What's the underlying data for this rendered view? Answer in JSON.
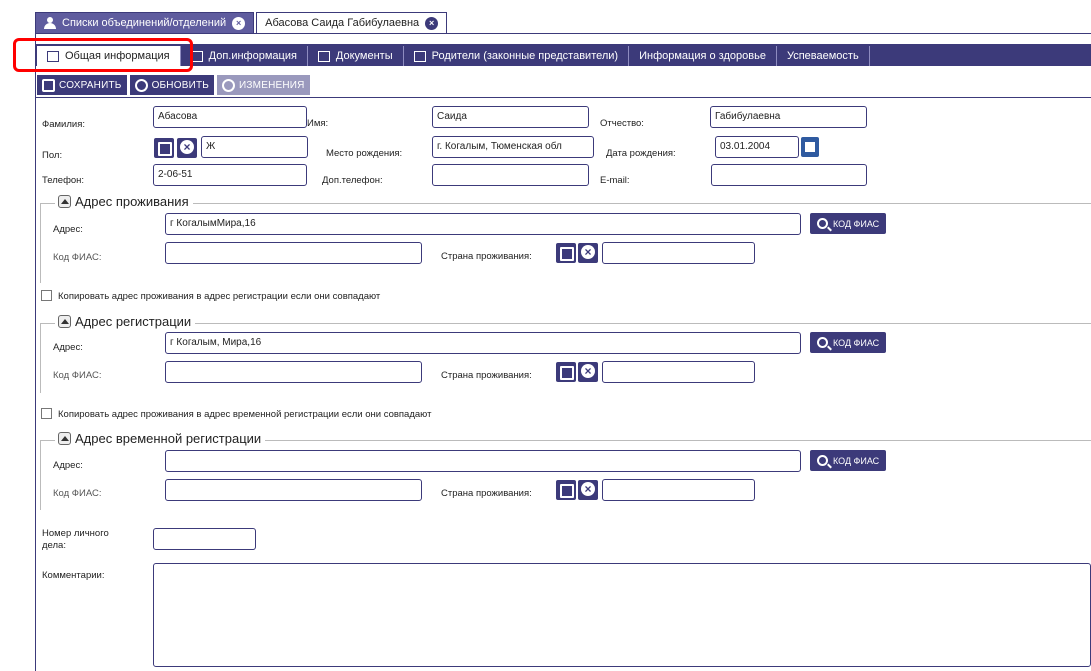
{
  "top_tabs": [
    {
      "label": "Списки объединений/отделений"
    },
    {
      "label": "Абасова Саида Габибулаевна"
    }
  ],
  "sub_tabs": [
    {
      "label": "Общая информация"
    },
    {
      "label": "Доп.информация"
    },
    {
      "label": "Документы"
    },
    {
      "label": "Родители (законные представители)"
    },
    {
      "label": "Информация о здоровье"
    },
    {
      "label": "Успеваемость"
    }
  ],
  "toolbar": {
    "save": "СОХРАНИТЬ",
    "refresh": "ОБНОВИТЬ",
    "changes": "ИЗМЕНЕНИЯ"
  },
  "person": {
    "surname_label": "Фамилия:",
    "surname": "Абасова",
    "name_label": "Имя:",
    "name": "Саида",
    "patronymic_label": "Отчество:",
    "patronymic": "Габибулаевна",
    "gender_label": "Пол:",
    "gender": "Ж",
    "birthplace_label": "Место рождения:",
    "birthplace": "г. Когалым, Тюменская обл",
    "birthdate_label": "Дата рождения:",
    "birthdate": "03.01.2004",
    "phone_label": "Телефон:",
    "phone": "2-06-51",
    "phone2_label": "Доп.телефон:",
    "phone2": "",
    "email_label": "E-mail:",
    "email": ""
  },
  "residence": {
    "legend": "Адрес проживания",
    "address_label": "Адрес:",
    "address": "г КогалымМира,16",
    "fias_label": "Код ФИАС:",
    "fias": "",
    "country_label": "Страна проживания:",
    "country": "",
    "fias_button": "КОД ФИАС"
  },
  "copy_registration": "Копировать адрес проживания в адрес регистрации если они совпадают",
  "registration": {
    "legend": "Адрес регистрации",
    "address_label": "Адрес:",
    "address": "г Когалым, Мира,16",
    "fias_label": "Код ФИАС:",
    "fias": "",
    "country_label": "Страна проживания:",
    "country": "",
    "fias_button": "КОД ФИАС"
  },
  "copy_temp_registration": "Копировать адрес проживания в адрес временной регистрации если они совпадают",
  "temp_registration": {
    "legend": "Адрес временной регистрации",
    "address_label": "Адрес:",
    "address": "",
    "fias_label": "Код ФИАС:",
    "fias": "",
    "country_label": "Страна проживания:",
    "country": "",
    "fias_button": "КОД ФИАС"
  },
  "case_number_label_1": "Номер личного",
  "case_number_label_2": "дела:",
  "case_number": "",
  "comments_label": "Комментарии:",
  "comments": "",
  "colors": {
    "primary": "#3c3a7a",
    "highlight": "#ff0000",
    "calendar": "#2f5aa0"
  }
}
